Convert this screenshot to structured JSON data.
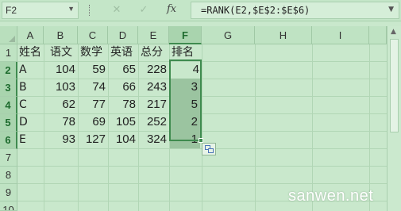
{
  "formula_bar": {
    "name_box": "F2",
    "fx": "fx",
    "formula": "=RANK(E2,$E$2:$E$6)"
  },
  "columns": [
    "A",
    "B",
    "C",
    "D",
    "E",
    "F",
    "G",
    "H",
    "I"
  ],
  "rows": [
    "1",
    "2",
    "3",
    "4",
    "5",
    "6",
    "7",
    "8",
    "9",
    "10"
  ],
  "selected_column": "F",
  "headers": {
    "name": "姓名",
    "chinese": "语文",
    "math": "数学",
    "english": "英语",
    "total": "总分",
    "rank": "排名"
  },
  "data_rows": [
    {
      "name": "A",
      "chinese": "104",
      "math": "59",
      "english": "65",
      "total": "228",
      "rank": "4"
    },
    {
      "name": "B",
      "chinese": "103",
      "math": "74",
      "english": "66",
      "total": "243",
      "rank": "3"
    },
    {
      "name": "C",
      "chinese": "62",
      "math": "77",
      "english": "78",
      "total": "217",
      "rank": "5"
    },
    {
      "name": "D",
      "chinese": "78",
      "math": "69",
      "english": "105",
      "total": "252",
      "rank": "2"
    },
    {
      "name": "E",
      "chinese": "93",
      "math": "127",
      "english": "104",
      "total": "324",
      "rank": "1"
    }
  ],
  "watermark": "sanwen.net",
  "colors": {
    "sheet_background": "#c9e8cc",
    "selection_border": "#3f8b4f",
    "selection_fill": "#9bc4a0"
  }
}
